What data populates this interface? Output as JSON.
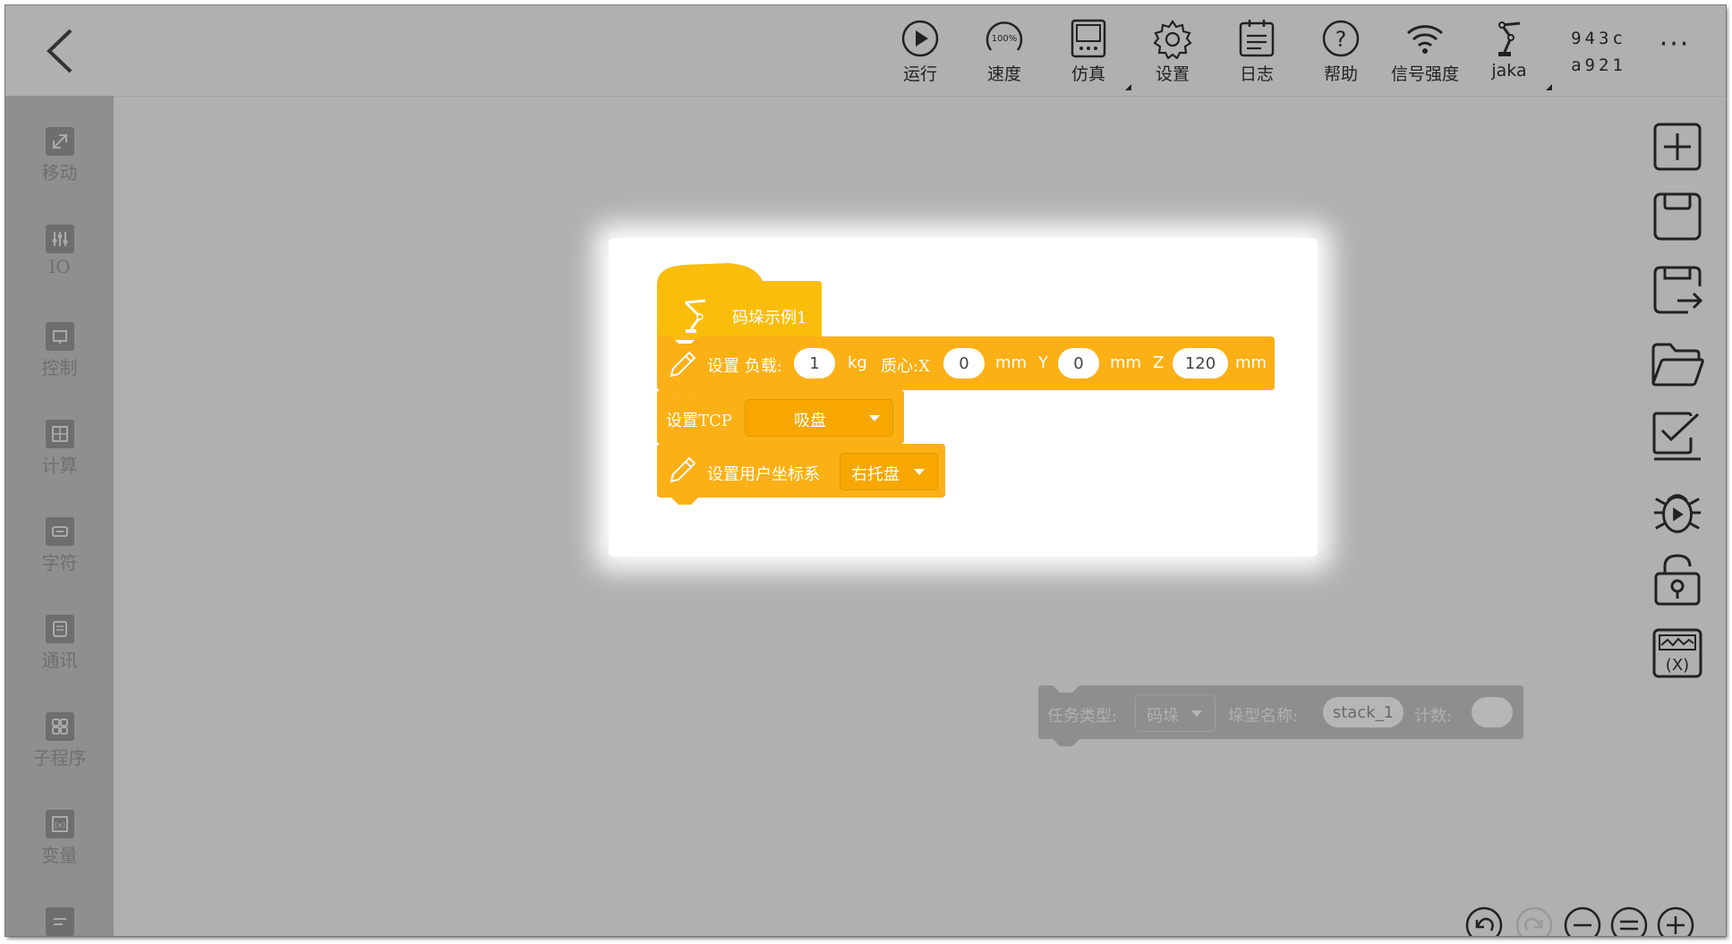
{
  "toolbar": {
    "items": [
      {
        "label": "运行",
        "icon": "play-icon"
      },
      {
        "label": "速度",
        "icon": "speed-gauge-icon",
        "badge": "100%"
      },
      {
        "label": "仿真",
        "icon": "simulation-icon"
      },
      {
        "label": "设置",
        "icon": "gear-icon"
      },
      {
        "label": "日志",
        "icon": "log-icon"
      },
      {
        "label": "帮助",
        "icon": "help-icon"
      },
      {
        "label": "信号强度",
        "icon": "wifi-icon"
      },
      {
        "label": "jaka",
        "icon": "robot-arm-icon"
      }
    ],
    "serial_line1": "943c",
    "serial_line2": "a921",
    "more": "···"
  },
  "sidebar": {
    "items": [
      {
        "label": "移动",
        "icon": "move-icon"
      },
      {
        "label": "IO",
        "icon": "io-icon"
      },
      {
        "label": "控制",
        "icon": "control-icon"
      },
      {
        "label": "计算",
        "icon": "calc-icon"
      },
      {
        "label": "字符",
        "icon": "string-icon"
      },
      {
        "label": "通讯",
        "icon": "comm-icon"
      },
      {
        "label": "子程序",
        "icon": "subprogram-icon"
      },
      {
        "label": "变量",
        "icon": "variable-icon"
      },
      {
        "label": "",
        "icon": "extra-icon"
      }
    ]
  },
  "program": {
    "hat_title": "码垛示例1",
    "payload": {
      "set_label": "设置 负载:",
      "mass": "1",
      "mass_unit": "kg",
      "com_label": "质心:X",
      "x": "0",
      "x_unit": "mm",
      "y_label": "Y",
      "y": "0",
      "y_unit": "mm",
      "z_label": "Z",
      "z": "120",
      "z_unit": "mm"
    },
    "tcp": {
      "label": "设置TCP",
      "value": "吸盘"
    },
    "user_frame": {
      "label": "设置用户坐标系",
      "value": "右托盘"
    }
  },
  "floating_block": {
    "task_type_label": "任务类型:",
    "task_type_value": "码垛",
    "stack_name_label": "垛型名称:",
    "stack_name_value": "stack_1",
    "count_label": "计数:",
    "count_value": ""
  },
  "right_toolbar": [
    "add-icon",
    "save-icon",
    "save-as-icon",
    "open-folder-icon",
    "checklist-icon",
    "debug-icon",
    "unlock-icon",
    "variable-monitor-icon"
  ],
  "zoom_controls": [
    "undo-icon",
    "redo-icon",
    "zoom-out-icon",
    "zoom-reset-icon",
    "zoom-in-icon"
  ],
  "colors": {
    "block_orange": "#fbb016",
    "hat_yellow": "#fbbd0c",
    "floating_grey": "#8e8e8e",
    "background_grey": "#b0b0b0",
    "sidebar_grey": "#8f8f8f"
  }
}
